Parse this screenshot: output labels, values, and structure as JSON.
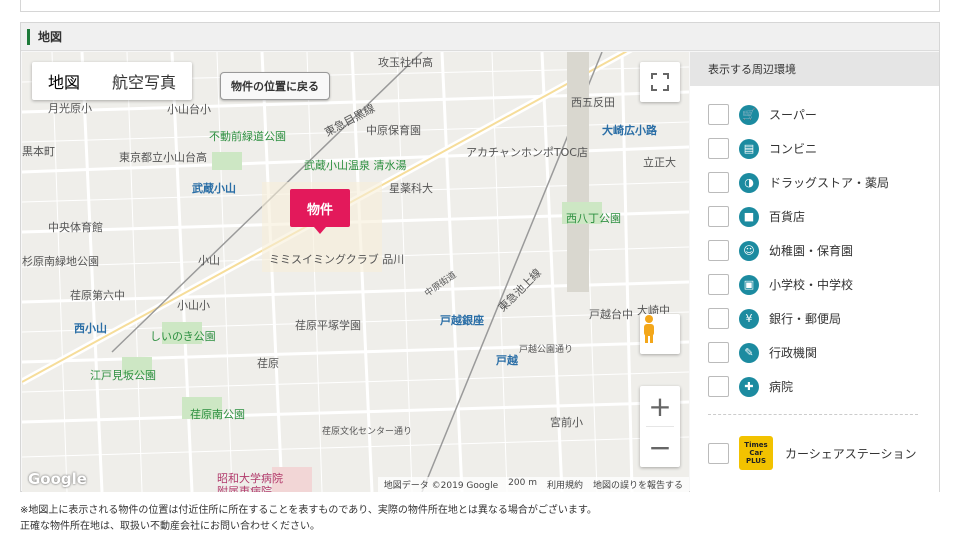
{
  "section": {
    "title": "地図"
  },
  "map": {
    "type_tabs": [
      "地図",
      "航空写真"
    ],
    "back_button": "物件の位置に戻る",
    "marker": "物件",
    "attribution": {
      "data": "地図データ ©2019 Google",
      "scale": "200 m",
      "terms": "利用規約",
      "report": "地図の誤りを報告する"
    },
    "logo": "Google",
    "labels": [
      "攻玉社中高",
      "月光原小",
      "小山台小",
      "西五反田",
      "黒本町",
      "中原保育園",
      "不動前緑道公園",
      "大崎広小路",
      "東京都立小山台高",
      "アカチャンホンポTOC店",
      "立正大",
      "武蔵小山温泉 清水湯",
      "武蔵小山",
      "星薬科大",
      "中央体育館",
      "西八丁公園",
      "杉原南緑地公園",
      "ミミスイミングクラブ 品川",
      "小山",
      "荏原第六中",
      "戸越台中",
      "大崎中",
      "小山小",
      "西小山",
      "荏原平塚学園",
      "戸越銀座",
      "しいのき公園",
      "戸越",
      "荏原",
      "江戸見坂公園",
      "荏原南公園",
      "宮前小",
      "昭和大学病院",
      "附属東病院",
      "東急目黒線",
      "東急池上線",
      "荏原文化センター通り",
      "戸越公園通り",
      "中原街道"
    ]
  },
  "side": {
    "heading": "表示する周辺環境",
    "items": [
      {
        "label": "スーパー",
        "icon": "cart-icon"
      },
      {
        "label": "コンビニ",
        "icon": "store-icon"
      },
      {
        "label": "ドラッグストア・薬局",
        "icon": "pill-icon"
      },
      {
        "label": "百貨店",
        "icon": "bag-icon"
      },
      {
        "label": "幼稚園・保育園",
        "icon": "child-icon"
      },
      {
        "label": "小学校・中学校",
        "icon": "school-icon"
      },
      {
        "label": "銀行・郵便局",
        "icon": "bank-icon"
      },
      {
        "label": "行政機関",
        "icon": "clipboard-icon"
      },
      {
        "label": "病院",
        "icon": "hospital-icon"
      }
    ],
    "car_share": {
      "label": "カーシェアステーション",
      "logo_line1": "Times",
      "logo_line2": "Car",
      "logo_line3": "PLUS"
    }
  },
  "footer_note": [
    "※地図上に表示される物件の位置は付近住所に所在することを表すものであり、実際の物件所在地とは異なる場合がございます。",
    "正確な物件所在地は、取扱い不動産会社にお問い合わせください。"
  ]
}
